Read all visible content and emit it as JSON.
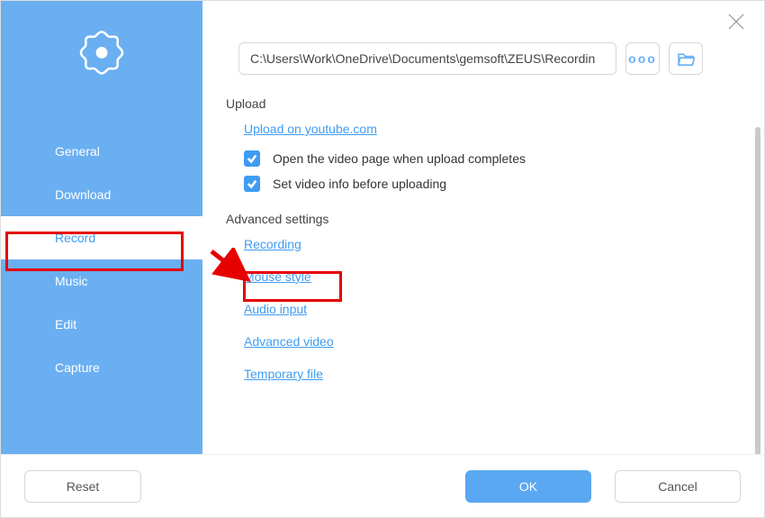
{
  "path": {
    "value": "C:\\Users\\Work\\OneDrive\\Documents\\gemsoft\\ZEUS\\Recordin"
  },
  "sidebar": {
    "items": [
      {
        "label": "General"
      },
      {
        "label": "Download"
      },
      {
        "label": "Record",
        "active": true
      },
      {
        "label": "Music"
      },
      {
        "label": "Edit"
      },
      {
        "label": "Capture"
      }
    ]
  },
  "upload": {
    "title": "Upload",
    "youtube_link": "Upload on youtube.com",
    "open_page_label": "Open the video page when upload completes",
    "set_info_label": "Set video info before uploading"
  },
  "advanced": {
    "title": "Advanced settings",
    "links": {
      "recording": "Recording",
      "mouse_style": "Mouse style",
      "audio_input": "Audio input",
      "advanced_video": "Advanced video",
      "temporary_file": "Temporary file"
    }
  },
  "footer": {
    "reset": "Reset",
    "ok": "OK",
    "cancel": "Cancel"
  }
}
